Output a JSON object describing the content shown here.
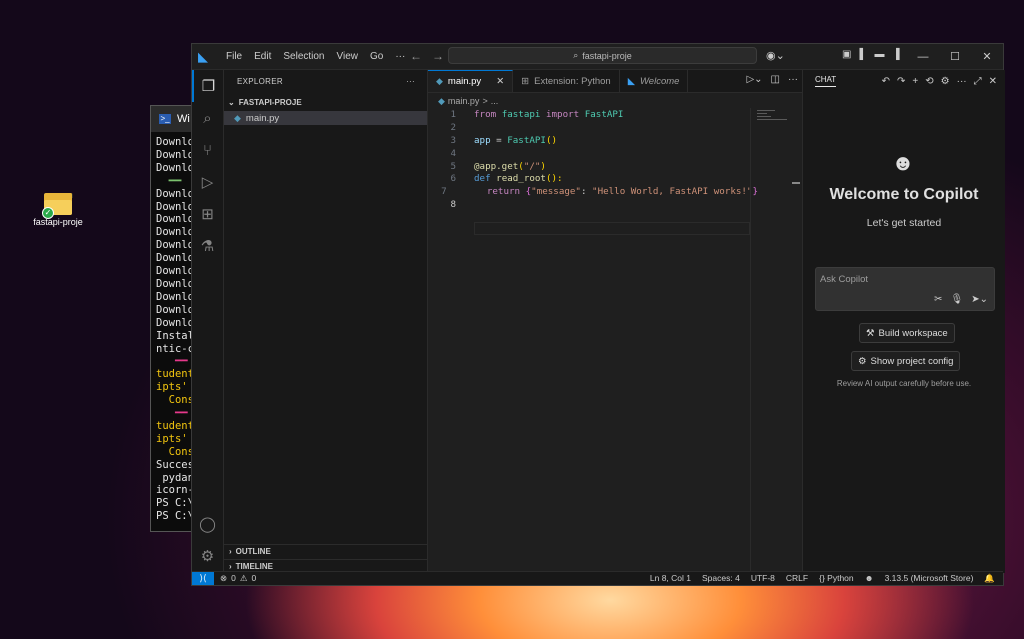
{
  "desktop": {
    "icon_label": "fastapi-proje"
  },
  "powershell": {
    "title": "Wi",
    "lines": [
      {
        "t": "Downlo",
        "c": ""
      },
      {
        "t": "Downlo",
        "c": ""
      },
      {
        "t": "Downlo",
        "c": ""
      },
      {
        "t": "  ━━",
        "c": "g"
      },
      {
        "t": "Downlo",
        "c": ""
      },
      {
        "t": "Downlo",
        "c": ""
      },
      {
        "t": "Downlo",
        "c": ""
      },
      {
        "t": "Downlo",
        "c": ""
      },
      {
        "t": "Downlo",
        "c": ""
      },
      {
        "t": "Downlo",
        "c": ""
      },
      {
        "t": "Downlo",
        "c": ""
      },
      {
        "t": "Downlo",
        "c": ""
      },
      {
        "t": "Downlo",
        "c": ""
      },
      {
        "t": "Downlo",
        "c": ""
      },
      {
        "t": "Downlo",
        "c": ""
      },
      {
        "t": "Instal",
        "c": ""
      },
      {
        "t": "ntic-c",
        "c": ""
      },
      {
        "t": "   ━━",
        "c": "p"
      },
      {
        "t": "tudent",
        "c": "y"
      },
      {
        "t": "ipts'",
        "c": "y"
      },
      {
        "t": "  Cons",
        "c": "y"
      },
      {
        "t": "   ━━",
        "c": "p"
      },
      {
        "t": "tudent",
        "c": "y"
      },
      {
        "t": "ipts'",
        "c": "y"
      },
      {
        "t": "  Cons",
        "c": "y"
      },
      {
        "t": "Succes",
        "c": ""
      },
      {
        "t": " pydan",
        "c": ""
      },
      {
        "t": "icorn-",
        "c": ""
      },
      {
        "t": "PS C:\\",
        "c": ""
      },
      {
        "t": "PS C:\\",
        "c": ""
      }
    ]
  },
  "titlebar": {
    "menu": [
      "File",
      "Edit",
      "Selection",
      "View",
      "Go",
      "···"
    ],
    "search": "fastapi-proje"
  },
  "explorer": {
    "header": "EXPLORER",
    "more": "···",
    "folder": "FASTAPI-PROJE",
    "file": "main.py",
    "outline": "OUTLINE",
    "timeline": "TIMELINE"
  },
  "editor": {
    "tabs": [
      {
        "label": "main.py",
        "icon": "python-file-icon"
      },
      {
        "label": "Extension: Python",
        "icon": "extension-icon"
      },
      {
        "label": "Welcome",
        "icon": "vscode-icon"
      }
    ],
    "breadcrumb": [
      "main.py",
      ">",
      "..."
    ],
    "line_numbers": [
      "1",
      "2",
      "3",
      "4",
      "5",
      "6",
      "7",
      "8"
    ],
    "code": {
      "l1_from": "from",
      "l1_mod": "fastapi",
      "l1_import": "import",
      "l1_name": "FastAPI",
      "l3_var": "app",
      "l3_eq": " = ",
      "l3_fn": "FastAPI",
      "l3_paren": "()",
      "l5_dec": "@app.get",
      "l5_open": "(",
      "l5_str": "\"/\"",
      "l5_close": ")",
      "l6_def": "def",
      "l6_fn": "read_root",
      "l6_rest": "():",
      "l7_return": "return",
      "l7_open": "{",
      "l7_key": "\"message\"",
      "l7_colon": ": ",
      "l7_val": "\"Hello World, FastAPI works!\"",
      "l7_close": "}"
    }
  },
  "chat": {
    "tab": "CHAT",
    "welcome": "Welcome to Copilot",
    "subtitle": "Let's get started",
    "placeholder": "Ask Copilot",
    "build_btn": "Build workspace",
    "config_btn": "Show project config",
    "disclaimer": "Review AI output carefully before use."
  },
  "status": {
    "errors": "0",
    "warnings": "0",
    "position": "Ln 8, Col 1",
    "spaces": "Spaces: 4",
    "encoding": "UTF-8",
    "eol": "CRLF",
    "language": "Python",
    "interpreter": "3.13.5 (Microsoft Store)"
  },
  "colors": {
    "accent": "#0078d4",
    "vscode_blue": "#3aa0f3"
  }
}
